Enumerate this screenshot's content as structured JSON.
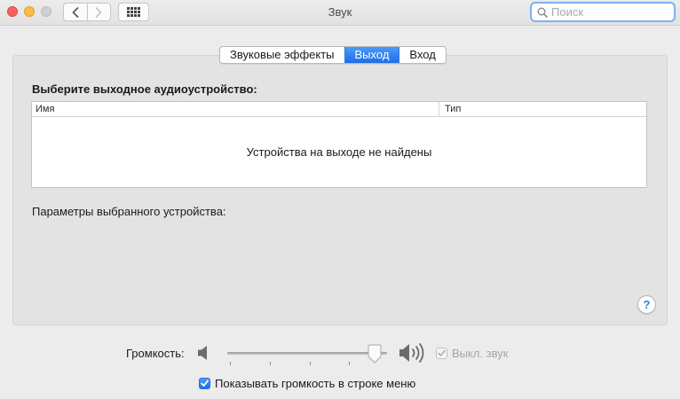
{
  "window": {
    "title": "Звук"
  },
  "search": {
    "placeholder": "Поиск"
  },
  "tabs": [
    {
      "label": "Звуковые эффекты",
      "active": false
    },
    {
      "label": "Выход",
      "active": true
    },
    {
      "label": "Вход",
      "active": false
    }
  ],
  "output": {
    "heading": "Выберите выходное аудиоустройство:",
    "columns": {
      "name": "Имя",
      "type": "Тип"
    },
    "empty_message": "Устройства на выходе не найдены",
    "params_label": "Параметры выбранного устройства:"
  },
  "help": {
    "label": "?"
  },
  "volume": {
    "label": "Громкость:",
    "level": 0.92,
    "mute_label": "Выкл. звук",
    "mute_checked": true,
    "mute_enabled": false,
    "show_in_menu_label": "Показывать громкость в строке меню",
    "show_in_menu_checked": true
  },
  "colors": {
    "accent": "#1d6ee8",
    "close": "#fc605c",
    "minimize": "#fdbc40"
  }
}
